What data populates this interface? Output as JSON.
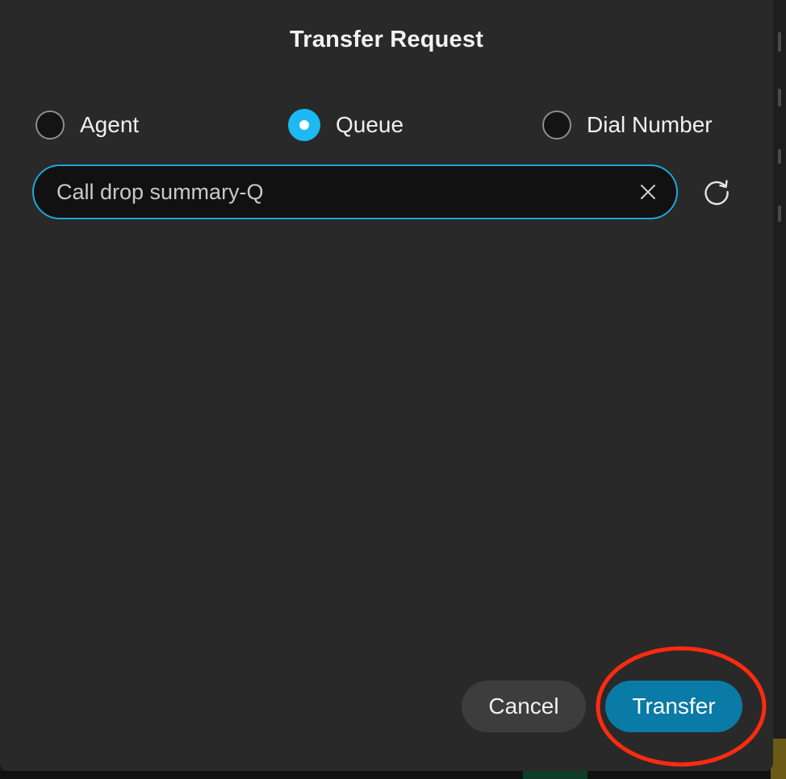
{
  "dialog": {
    "title": "Transfer Request"
  },
  "transfer_type": {
    "options": [
      {
        "label": "Agent",
        "checked": false
      },
      {
        "label": "Queue",
        "checked": true
      },
      {
        "label": "Dial Number",
        "checked": false
      }
    ]
  },
  "search": {
    "value": "Call drop summary-Q",
    "clear_icon": "close-icon",
    "refresh_icon": "refresh-icon"
  },
  "actions": {
    "cancel_label": "Cancel",
    "transfer_label": "Transfer"
  },
  "colors": {
    "accent": "#1cb9f2",
    "primary_button": "#0a7aa6",
    "annotation": "#ff2a10"
  }
}
